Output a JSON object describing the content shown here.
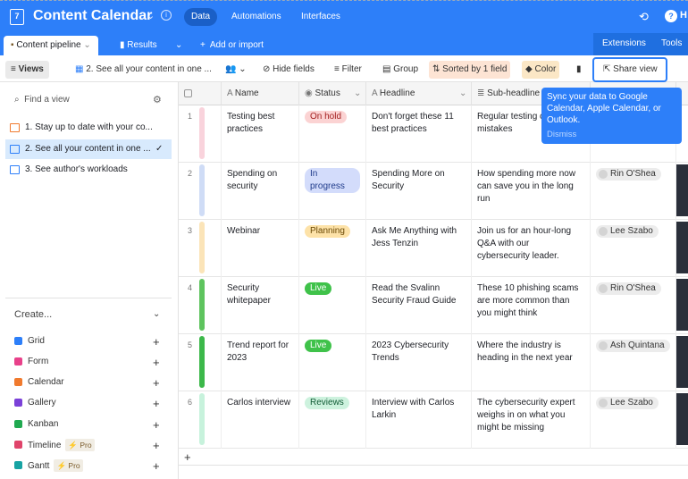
{
  "app": {
    "title": "Content Calendar",
    "tabs": [
      "Data",
      "Automations",
      "Interfaces"
    ],
    "help": "H"
  },
  "tables": {
    "active": "Content pipeline",
    "other": "Results",
    "add": "Add or import",
    "extensions": "Extensions",
    "tools": "Tools"
  },
  "toolbar": {
    "views": "Views",
    "current_view": "2. See all your content in one ...",
    "hide": "Hide fields",
    "filter": "Filter",
    "group": "Group",
    "sort": "Sorted by 1 field",
    "color": "Color",
    "share": "Share view"
  },
  "sidebar": {
    "find_placeholder": "Find a view",
    "views": [
      "1. Stay up to date with your co...",
      "2. See all your content in one ...",
      "3. See author's workloads"
    ],
    "create": "Create...",
    "create_items": [
      "Grid",
      "Form",
      "Calendar",
      "Gallery",
      "Kanban",
      "Timeline",
      "Gantt"
    ],
    "pro": "Pro"
  },
  "columns": [
    "Name",
    "Status",
    "Headline",
    "Sub-headline"
  ],
  "rows": [
    {
      "n": "1",
      "name": "Testing best practices",
      "status": "On hold",
      "headline": "Don't forget these 11 best practices",
      "sub": "Regular testing c big mistakes",
      "person": "",
      "bar": "#f9d3dc",
      "sbg": "#fbd3d3",
      "sfg": "#a32020"
    },
    {
      "n": "2",
      "name": "Spending on security",
      "status": "In progress",
      "headline": "Spending More on Security",
      "sub": "How spending more now can save you in the long run",
      "person": "Rin O'Shea",
      "bar": "#cfdcf6",
      "sbg": "#d3dcfb",
      "sfg": "#1e3a8a"
    },
    {
      "n": "3",
      "name": "Webinar",
      "status": "Planning",
      "headline": "Ask Me Anything with Jess Tenzin",
      "sub": "Join us for an hour-long Q&A with our cybersecurity leader.",
      "person": "Lee Szabo",
      "bar": "#fbe4b8",
      "sbg": "#fde2a8",
      "sfg": "#6b4a06"
    },
    {
      "n": "4",
      "name": "Security whitepaper",
      "status": "Live",
      "headline": "Read the Svalinn Security Fraud Guide",
      "sub": "These 10 phishing scams are more common than you might think",
      "person": "Rin O'Shea",
      "bar": "#5ec45e",
      "sbg": "#3fc24a",
      "sfg": "#ffffff"
    },
    {
      "n": "5",
      "name": "Trend report for 2023",
      "status": "Live",
      "headline": "2023 Cybersecurity Trends",
      "sub": "Where the industry is heading in the next year",
      "person": "Ash Quintana",
      "bar": "#3cb84a",
      "sbg": "#3fc24a",
      "sfg": "#ffffff"
    },
    {
      "n": "6",
      "name": "Carlos interview",
      "status": "Reviews",
      "headline": "Interview with Carlos Larkin",
      "sub": "The cybersecurity expert weighs in on what you might be missing",
      "person": "Lee Szabo",
      "bar": "#c7f2dc",
      "sbg": "#cdf2de",
      "sfg": "#0f5a34"
    }
  ],
  "tooltip": {
    "text": "Sync your data to Google Calendar, Apple Calendar, or Outlook.",
    "dismiss": "Dismiss"
  },
  "add_row": "+"
}
